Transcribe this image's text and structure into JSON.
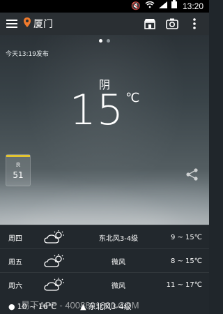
{
  "statusbar": {
    "time": "13:20"
  },
  "appbar": {
    "city": "厦门"
  },
  "page_indicator": {
    "active": 0,
    "total": 2
  },
  "current": {
    "publish": "今天13:19发布",
    "condition": "阴",
    "temperature": "15",
    "unit": "℃"
  },
  "aqi": {
    "label": "良",
    "value": "51",
    "color": "#e3c431"
  },
  "forecast": [
    {
      "day": "周四",
      "wind": "东北风3-4级",
      "range": "9 ~ 15℃",
      "icon": "partly-cloudy-icon"
    },
    {
      "day": "周五",
      "wind": "微风",
      "range": "8 ~ 15℃",
      "icon": "partly-cloudy-icon"
    },
    {
      "day": "周六",
      "wind": "微风",
      "range": "11 ~ 17℃",
      "icon": "partly-cloudy-icon"
    }
  ],
  "bottom": {
    "range": "10 ~ 16℃",
    "wind": "东北风3-4级"
  },
  "watermark": "易下APP - 4008891800.COM"
}
